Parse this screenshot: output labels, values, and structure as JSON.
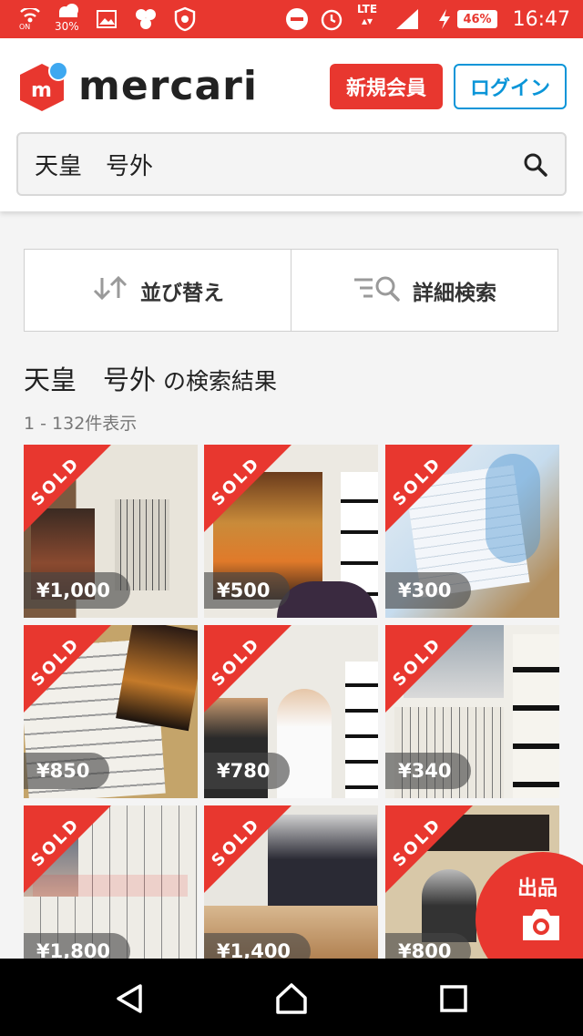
{
  "status_bar": {
    "time": "16:47",
    "battery": "46%",
    "network": "LTE",
    "notification_pct": "30%",
    "icons": [
      "wifi-calling-icon",
      "weather-icon",
      "gallery-icon",
      "app-icon",
      "vpn-icon",
      "dnd-icon",
      "alarm-icon",
      "signal-icon",
      "charging-icon"
    ]
  },
  "header": {
    "brand": "mercari",
    "brand_color": "#e8372f",
    "signup_label": "新規会員",
    "login_label": "ログイン"
  },
  "search": {
    "query": "天皇　号外"
  },
  "controls": {
    "sort_label": "並び替え",
    "filter_label": "詳細検索"
  },
  "results": {
    "title_query": "天皇　号外",
    "title_suffix": " の検索結果",
    "count": "1 - 132件表示"
  },
  "items": [
    {
      "sold_label": "SOLD",
      "price": "¥1,000"
    },
    {
      "sold_label": "SOLD",
      "price": "¥500"
    },
    {
      "sold_label": "SOLD",
      "price": "¥300"
    },
    {
      "sold_label": "SOLD",
      "price": "¥850"
    },
    {
      "sold_label": "SOLD",
      "price": "¥780"
    },
    {
      "sold_label": "SOLD",
      "price": "¥340"
    },
    {
      "sold_label": "SOLD",
      "price": "¥1,800"
    },
    {
      "sold_label": "SOLD",
      "price": "¥1,400"
    },
    {
      "sold_label": "SOLD",
      "price": "¥800"
    }
  ],
  "fab": {
    "label": "出品"
  },
  "nav": {
    "icons": [
      "back-icon",
      "home-icon",
      "recents-icon"
    ]
  }
}
